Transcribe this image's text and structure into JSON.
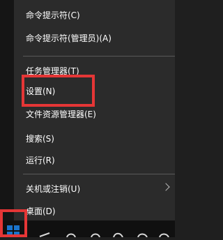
{
  "menu": {
    "items": [
      {
        "label": "命令提示符(C)",
        "highlighted": false,
        "has_submenu": false
      },
      {
        "label": "命令提示符(管理员)(A)",
        "highlighted": false,
        "has_submenu": false
      },
      {
        "label": "任务管理器(T)",
        "highlighted": false,
        "has_submenu": false
      },
      {
        "label": "设置(N)",
        "highlighted": true,
        "has_submenu": false
      },
      {
        "label": "文件资源管理器(E)",
        "highlighted": false,
        "has_submenu": false
      },
      {
        "label": "搜索(S)",
        "highlighted": false,
        "has_submenu": false
      },
      {
        "label": "运行(R)",
        "highlighted": false,
        "has_submenu": false
      },
      {
        "label": "关机或注销(U)",
        "highlighted": false,
        "has_submenu": true
      },
      {
        "label": "桌面(D)",
        "highlighted": false,
        "has_submenu": false
      }
    ]
  },
  "taskbar": {
    "start_button_icon": "windows-logo-icon",
    "start_button_highlighted": true
  },
  "colors": {
    "menu_background": "#2b2b2b",
    "menu_text": "#ffffff",
    "separator": "#5a5a5a",
    "taskbar_background": "#101010",
    "highlight_red": "#e53636",
    "start_icon_blue": "#1a74cc"
  }
}
